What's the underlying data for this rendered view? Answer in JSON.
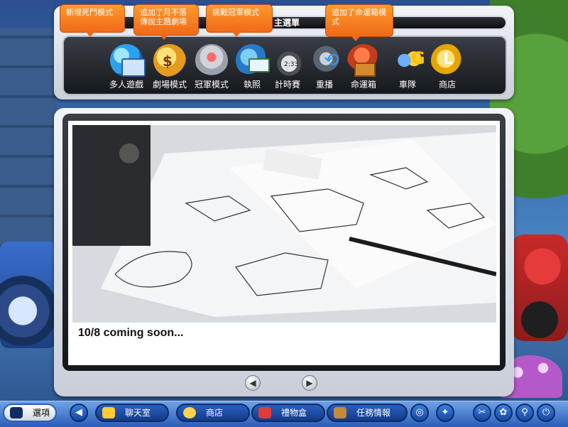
{
  "menu": {
    "title": "主選單",
    "items": [
      {
        "label": "多人遊戲",
        "icon": "globe-monitor-icon"
      },
      {
        "label": "劇場模式",
        "icon": "scroll-coin-icon"
      },
      {
        "label": "冠軍模式",
        "icon": "trophy-icon"
      },
      {
        "label": "執照",
        "icon": "license-card-icon"
      },
      {
        "label": "計時賽",
        "icon": "stopwatch-icon"
      },
      {
        "label": "重播",
        "icon": "replay-camera-icon"
      },
      {
        "label": "命運箱",
        "icon": "fortune-box-icon"
      },
      {
        "label": "車隊",
        "icon": "team-icon"
      },
      {
        "label": "商店",
        "icon": "shop-icon"
      }
    ]
  },
  "callouts": [
    {
      "text": "新增死鬥模式"
    },
    {
      "text": "追加了月不落傳說主題劇場"
    },
    {
      "text": "挑戰冠軍模式"
    },
    {
      "text": "追加了命運箱模式"
    }
  ],
  "content": {
    "caption": "10/8 coming soon..."
  },
  "taskbar": {
    "options_label": "選項",
    "chat_label": "聊天室",
    "shop_label": "商店",
    "gift_label": "禮物盒",
    "mission_label": "任務情報"
  }
}
